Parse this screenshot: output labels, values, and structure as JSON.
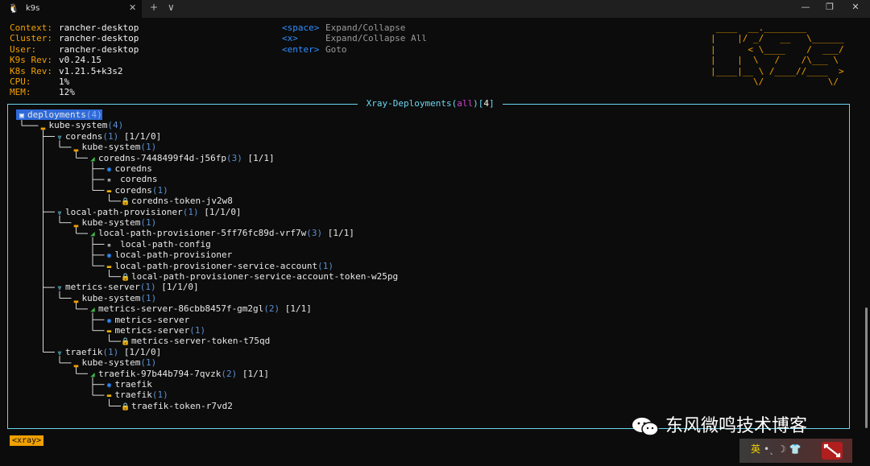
{
  "window": {
    "tab_title": "k9s",
    "tab_icon": "linux-penguin-icon",
    "new_tab": "+",
    "dropdown": "∨",
    "minimize": "—",
    "maximize": "❐",
    "close": "✕"
  },
  "info": [
    {
      "k": "Context:",
      "v": "rancher-desktop"
    },
    {
      "k": "Cluster:",
      "v": "rancher-desktop"
    },
    {
      "k": "User:",
      "v": "rancher-desktop"
    },
    {
      "k": "K9s Rev:",
      "v": "v0.24.15"
    },
    {
      "k": "K8s Rev:",
      "v": "v1.21.5+k3s2"
    },
    {
      "k": "CPU:",
      "v": "1%"
    },
    {
      "k": "MEM:",
      "v": "12%"
    }
  ],
  "keys": [
    {
      "k": "<space>",
      "v": "Expand/Collapse"
    },
    {
      "k": "<x>",
      "v": "Expand/Collapse All"
    },
    {
      "k": "<enter>",
      "v": "Goto"
    }
  ],
  "logo": [
    " ____  __.________       ",
    "|    |/ _/   __   \\______",
    "|      < \\____    /  ___/",
    "|    |  \\   /    /\\___ \\ ",
    "|____|__ \\ /____//____  >",
    "        \\/            \\/ "
  ],
  "panel": {
    "prefix": " Xray-Deployments(",
    "filter": "all",
    "mid": ")[",
    "count": "4",
    "suffix": "] "
  },
  "tree": [
    {
      "d": 0,
      "icon": "deployments-icon",
      "g": "▣",
      "c": "#2f6ad8",
      "label": "deployments",
      "count": "(4)",
      "status": "",
      "sel": true
    },
    {
      "d": 1,
      "icon": "namespace-icon",
      "g": "▂",
      "c": "#f0a000",
      "label": "kube-system",
      "count": "(4)",
      "status": ""
    },
    {
      "d": 2,
      "icon": "deployment-icon",
      "g": "⩔",
      "c": "#6ad6f0",
      "label": "coredns",
      "count": "(1)",
      "status": " [1/1/0]"
    },
    {
      "d": 3,
      "icon": "namespace-icon",
      "g": "▂",
      "c": "#f0a000",
      "label": "kube-system",
      "count": "(1)",
      "status": ""
    },
    {
      "d": 4,
      "icon": "pod-icon",
      "g": "◢",
      "c": "#3fb84a",
      "label": "coredns-7448499f4d-j56fp",
      "count": "(3)",
      "status": " [1/1]"
    },
    {
      "d": 5,
      "icon": "container-icon",
      "g": "◉",
      "c": "#2f8fff",
      "label": "coredns",
      "count": "",
      "status": ""
    },
    {
      "d": 5,
      "icon": "configmap-icon",
      "g": "▪",
      "c": "#9aa0a6",
      "label": " coredns",
      "count": "",
      "status": ""
    },
    {
      "d": 5,
      "icon": "serviceaccount-icon",
      "g": "▬",
      "c": "#f0b400",
      "label": "coredns",
      "count": "(1)",
      "status": ""
    },
    {
      "d": 6,
      "icon": "secret-icon",
      "g": "🔒",
      "c": "#f0b400",
      "label": "coredns-token-jv2w8",
      "count": "",
      "status": ""
    },
    {
      "d": 2,
      "icon": "deployment-icon",
      "g": "⩔",
      "c": "#6ad6f0",
      "label": "local-path-provisioner",
      "count": "(1)",
      "status": " [1/1/0]"
    },
    {
      "d": 3,
      "icon": "namespace-icon",
      "g": "▂",
      "c": "#f0a000",
      "label": "kube-system",
      "count": "(1)",
      "status": ""
    },
    {
      "d": 4,
      "icon": "pod-icon",
      "g": "◢",
      "c": "#3fb84a",
      "label": "local-path-provisioner-5ff76fc89d-vrf7w",
      "count": "(3)",
      "status": " [1/1]"
    },
    {
      "d": 5,
      "icon": "configmap-icon",
      "g": "▪",
      "c": "#9aa0a6",
      "label": " local-path-config",
      "count": "",
      "status": ""
    },
    {
      "d": 5,
      "icon": "container-icon",
      "g": "◉",
      "c": "#2f8fff",
      "label": "local-path-provisioner",
      "count": "",
      "status": ""
    },
    {
      "d": 5,
      "icon": "serviceaccount-icon",
      "g": "▬",
      "c": "#f0b400",
      "label": "local-path-provisioner-service-account",
      "count": "(1)",
      "status": ""
    },
    {
      "d": 6,
      "icon": "secret-icon",
      "g": "🔒",
      "c": "#f0b400",
      "label": "local-path-provisioner-service-account-token-w25pg",
      "count": "",
      "status": ""
    },
    {
      "d": 2,
      "icon": "deployment-icon",
      "g": "⩔",
      "c": "#6ad6f0",
      "label": "metrics-server",
      "count": "(1)",
      "status": " [1/1/0]"
    },
    {
      "d": 3,
      "icon": "namespace-icon",
      "g": "▂",
      "c": "#f0a000",
      "label": "kube-system",
      "count": "(1)",
      "status": ""
    },
    {
      "d": 4,
      "icon": "pod-icon",
      "g": "◢",
      "c": "#3fb84a",
      "label": "metrics-server-86cbb8457f-gm2gl",
      "count": "(2)",
      "status": " [1/1]"
    },
    {
      "d": 5,
      "icon": "container-icon",
      "g": "◉",
      "c": "#2f8fff",
      "label": "metrics-server",
      "count": "",
      "status": ""
    },
    {
      "d": 5,
      "icon": "serviceaccount-icon",
      "g": "▬",
      "c": "#f0b400",
      "label": "metrics-server",
      "count": "(1)",
      "status": ""
    },
    {
      "d": 6,
      "icon": "secret-icon",
      "g": "🔒",
      "c": "#f0b400",
      "label": "metrics-server-token-t75qd",
      "count": "",
      "status": ""
    },
    {
      "d": 2,
      "icon": "deployment-icon",
      "g": "⩔",
      "c": "#6ad6f0",
      "label": "traefik",
      "count": "(1)",
      "status": " [1/1/0]"
    },
    {
      "d": 3,
      "icon": "namespace-icon",
      "g": "▂",
      "c": "#f0a000",
      "label": "kube-system",
      "count": "(1)",
      "status": ""
    },
    {
      "d": 4,
      "icon": "pod-icon",
      "g": "◢",
      "c": "#3fb84a",
      "label": "traefik-97b44b794-7qvzk",
      "count": "(2)",
      "status": " [1/1]"
    },
    {
      "d": 5,
      "icon": "container-icon",
      "g": "◉",
      "c": "#2f8fff",
      "label": "traefik",
      "count": "",
      "status": ""
    },
    {
      "d": 5,
      "icon": "serviceaccount-icon",
      "g": "▬",
      "c": "#f0b400",
      "label": "traefik",
      "count": "(1)",
      "status": ""
    },
    {
      "d": 6,
      "icon": "secret-icon",
      "g": "🔒",
      "c": "#f0b400",
      "label": "traefik-token-r7vd2",
      "count": "",
      "status": ""
    }
  ],
  "crumb": "<xray>",
  "watermark": "东风微鸣技术博客",
  "tray": {
    "ime": "英",
    "icons": "•ˎ ☽ 👕"
  }
}
